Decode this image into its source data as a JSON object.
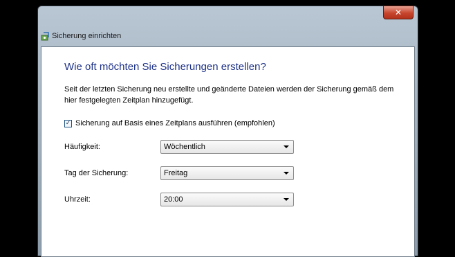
{
  "window": {
    "title": "Sicherung einrichten",
    "close_symbol": "✕"
  },
  "main": {
    "heading": "Wie oft möchten Sie Sicherungen erstellen?",
    "description": "Seit der letzten Sicherung neu erstellte und geänderte Dateien werden der Sicherung gemäß dem hier festgelegten Zeitplan hinzugefügt.",
    "schedule_checkbox": {
      "label": "Sicherung auf Basis eines Zeitplans ausführen (empfohlen)",
      "checked": true,
      "check_mark": "✓"
    },
    "fields": [
      {
        "label": "Häufigkeit:",
        "value": "Wöchentlich"
      },
      {
        "label": "Tag der Sicherung:",
        "value": "Freitag"
      },
      {
        "label": "Uhrzeit:",
        "value": "20:00"
      }
    ]
  },
  "icons": {
    "title_icon": "backup-icon",
    "close_icon": "close-icon",
    "dropdown_icon": "chevron-down-icon"
  },
  "colors": {
    "heading": "#1e3287",
    "close_button": "#c7452d"
  }
}
